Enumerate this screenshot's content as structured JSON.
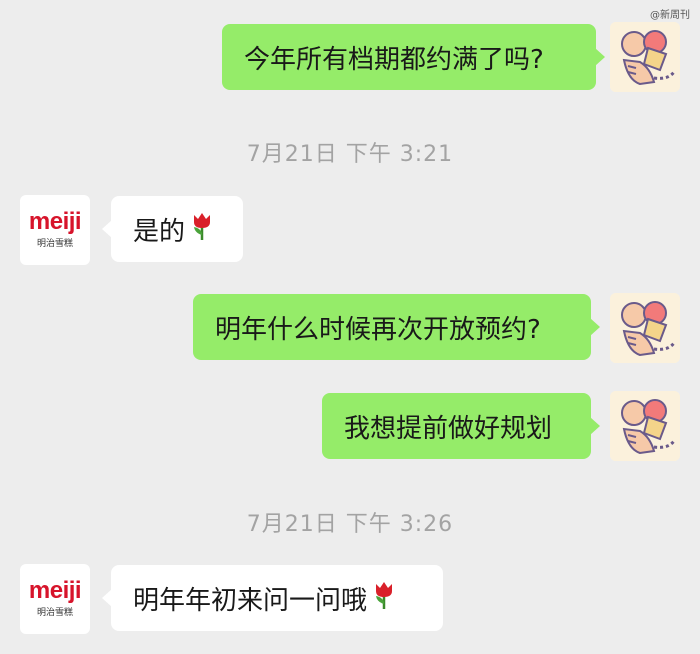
{
  "watermark": "@新周刊",
  "messages": [
    {
      "text": "今年所有档期都约满了吗?"
    },
    {
      "text": "是的"
    },
    {
      "text": "明年什么时候再次开放预约?"
    },
    {
      "text": "我想提前做好规划"
    },
    {
      "text": "明年年初来问一问哦"
    }
  ],
  "timestamps": [
    "7月21日 下午 3:21",
    "7月21日 下午 3:26"
  ],
  "contact": {
    "logo_text": "meiji",
    "logo_subtext": "明治雪糕"
  },
  "colors": {
    "background": "#ededed",
    "outgoing_bubble": "#95ec69",
    "incoming_bubble": "#ffffff",
    "brand_red": "#d7142b"
  },
  "icons": {
    "emoji": "tulip-emoji",
    "user_avatar": "tiger-avatar"
  }
}
